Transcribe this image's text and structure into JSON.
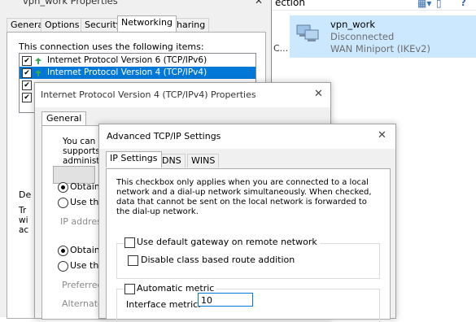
{
  "explorer": {
    "toolbar_label": "ection",
    "connection": {
      "name": "vpn_work",
      "status": "Disconnected",
      "device": "WAN Miniport (IKEv2)"
    },
    "partial_label": "C..."
  },
  "properties_dialog": {
    "title": "vpn_work Properties",
    "tabs": [
      "General",
      "Options",
      "Security",
      "Networking",
      "Sharing"
    ],
    "active_tab": "Networking",
    "uses_label": "This connection uses the following items:",
    "items": [
      {
        "label": "Internet Protocol Version 6 (TCP/IPv6)",
        "checked": true,
        "selected": false
      },
      {
        "label": "Internet Protocol Version 4 (TCP/IPv4)",
        "checked": true,
        "selected": true
      },
      {
        "label": "",
        "checked": true,
        "selected": false
      },
      {
        "label": "",
        "checked": true,
        "selected": false
      }
    ],
    "description_label": "De",
    "description_text": [
      "Tr",
      "wi",
      "ac"
    ]
  },
  "ipv4_dialog": {
    "title": "Internet Protocol Version 4 (TCP/IPv4) Properties",
    "tab": "General",
    "intro_lines": [
      "You can get IP",
      "supports this c",
      "administrator fo"
    ],
    "radio_obtain_ip": "Obtain an",
    "radio_use_ip": "Use the f",
    "ip_address_label": "IP address:",
    "radio_obtain_dns": "Obtain D",
    "radio_use_dns": "Use the f",
    "preferred_dns_label": "Preferred D",
    "alternate_dns_label": "Alternate D"
  },
  "advanced_dialog": {
    "title": "Advanced TCP/IP Settings",
    "tabs": [
      "IP Settings",
      "DNS",
      "WINS"
    ],
    "active_tab": "IP Settings",
    "description": "This checkbox only applies when you are connected to a local network and a dial-up network simultaneously.  When checked, data that cannot be sent on the local network is forwarded to the dial-up network.",
    "use_default_gateway_label": "Use default gateway on remote network",
    "use_default_gateway_checked": false,
    "disable_class_route_label": "Disable class based route addition",
    "disable_class_route_checked": false,
    "automatic_metric_label": "Automatic metric",
    "automatic_metric_checked": false,
    "interface_metric_label": "Interface metric:",
    "interface_metric_value": "10"
  },
  "colors": {
    "selection": "#0078d7",
    "tile_highlight": "#cce8ff"
  }
}
